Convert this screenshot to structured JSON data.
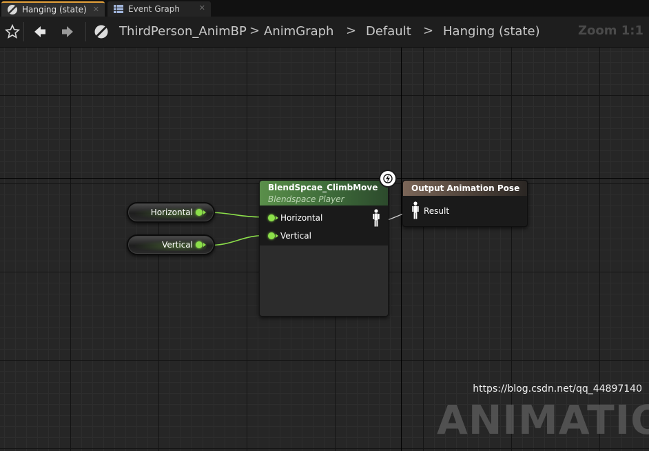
{
  "tabs": [
    {
      "label": "Hanging (state)",
      "icon": "state-icon",
      "active": true
    },
    {
      "label": "Event Graph",
      "icon": "graph-icon",
      "active": false
    }
  ],
  "toolbar": {
    "favorite_icon": "star-icon",
    "back_icon": "back-arrow-icon",
    "forward_icon": "forward-arrow-icon",
    "asset_icon": "anim-blueprint-icon",
    "breadcrumb": [
      "ThirdPerson_AnimBP",
      "AnimGraph",
      "Default",
      "Hanging (state)"
    ],
    "zoom": "Zoom 1:1"
  },
  "graph": {
    "variables": [
      {
        "label": "Horizontal",
        "type_color": "#8ce04a"
      },
      {
        "label": "Vertical",
        "type_color": "#8ce04a"
      }
    ],
    "blendspace_node": {
      "title": "BlendSpcae_ClimbMove",
      "subtitle": "Blendspace Player",
      "inputs": [
        "Horizontal",
        "Vertical"
      ],
      "output_icon": "pose-icon",
      "badge_icon": "fast-path-lightning-icon",
      "header_color": "#5a8f4a"
    },
    "output_node": {
      "title": "Output Animation Pose",
      "input": "Result",
      "input_icon": "pose-icon",
      "header_color": "#7b6658"
    }
  },
  "watermark": {
    "text": "ANIMATION",
    "url": "https://blog.csdn.net/qq_44897140"
  }
}
